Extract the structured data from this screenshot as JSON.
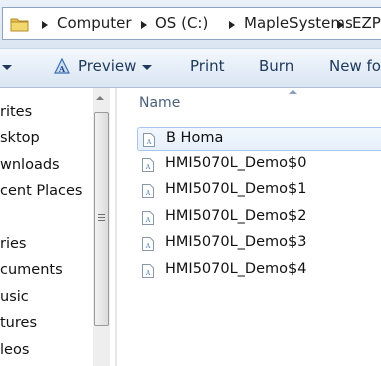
{
  "address": {
    "breadcrumbs": [
      "Computer",
      "OS (C:)",
      "MapleSystems",
      "EZPI"
    ]
  },
  "toolbar": {
    "items": [
      "Preview",
      "Print",
      "Burn",
      "New fol"
    ]
  },
  "nav": {
    "items": [
      "rites",
      "sktop",
      "wnloads",
      "cent Places",
      "ries",
      "cuments",
      "usic",
      "tures",
      "leos"
    ]
  },
  "list": {
    "column_name": "Name",
    "files": [
      "B Homa",
      "HMI5070L_Demo$0",
      "HMI5070L_Demo$1",
      "HMI5070L_Demo$2",
      "HMI5070L_Demo$3",
      "HMI5070L_Demo$4"
    ],
    "selected_file": "B Homa"
  }
}
